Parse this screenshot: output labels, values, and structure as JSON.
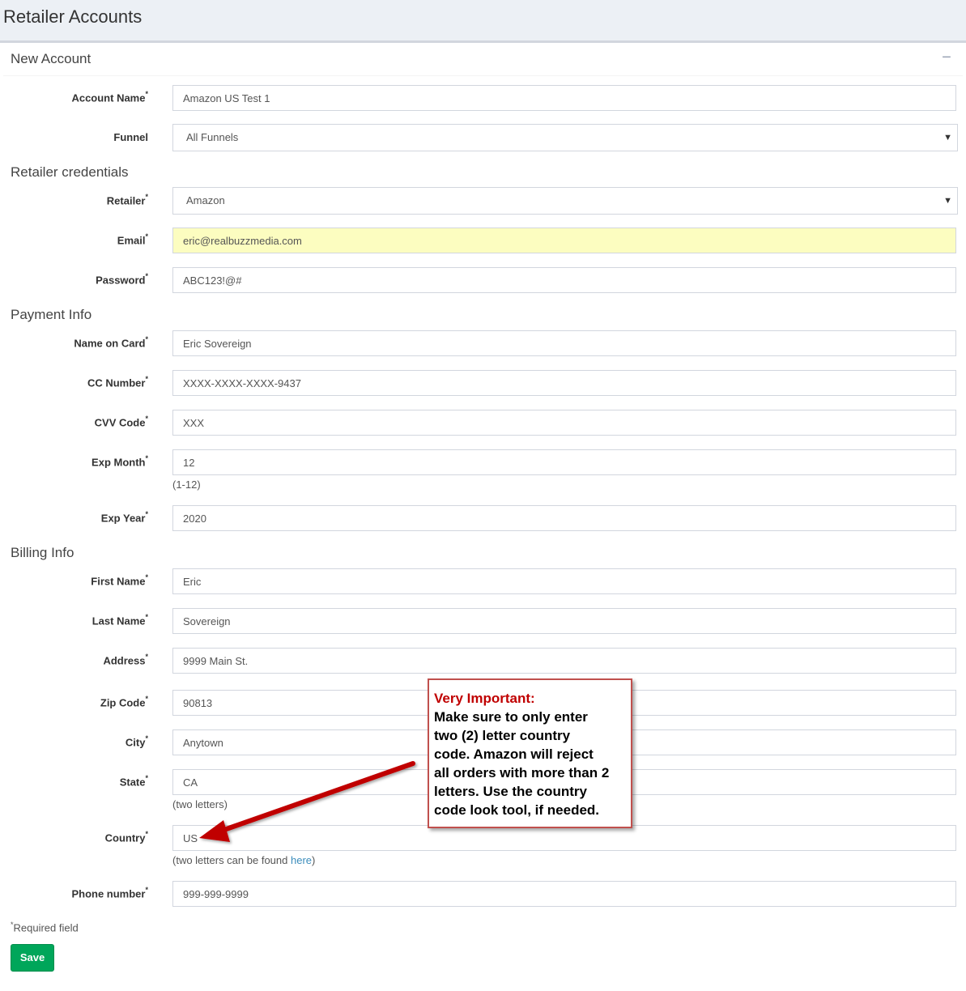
{
  "page": {
    "title": "Retailer Accounts"
  },
  "box": {
    "title": "New Account",
    "collapse_symbol": "−"
  },
  "fields": {
    "account_name": {
      "label": "Account Name",
      "value": "Amazon US Test 1"
    },
    "funnel": {
      "label": "Funnel",
      "value": "All Funnels"
    },
    "retailer": {
      "label": "Retailer",
      "value": "Amazon"
    },
    "email": {
      "label": "Email",
      "value": "eric@realbuzzmedia.com"
    },
    "password": {
      "label": "Password",
      "value": "ABC123!@#"
    },
    "name_on_card": {
      "label": "Name on Card",
      "value": "Eric Sovereign"
    },
    "cc_number": {
      "label": "CC Number",
      "value": "XXXX-XXXX-XXXX-9437"
    },
    "cvv_code": {
      "label": "CVV Code",
      "value": "XXX"
    },
    "exp_month": {
      "label": "Exp Month",
      "value": "12",
      "help": "(1-12)"
    },
    "exp_year": {
      "label": "Exp Year",
      "value": "2020"
    },
    "first_name": {
      "label": "First Name",
      "value": "Eric"
    },
    "last_name": {
      "label": "Last Name",
      "value": "Sovereign"
    },
    "address": {
      "label": "Address",
      "value": "9999 Main St."
    },
    "zip_code": {
      "label": "Zip Code",
      "value": "90813"
    },
    "city": {
      "label": "City",
      "value": "Anytown"
    },
    "state": {
      "label": "State",
      "value": "CA",
      "help": "(two letters)"
    },
    "country": {
      "label": "Country",
      "value": "US",
      "help_prefix": "(two letters can be found ",
      "help_link": "here",
      "help_suffix": ")"
    },
    "phone": {
      "label": "Phone number",
      "value": "999-999-9999"
    }
  },
  "sections": {
    "credentials": "Retailer credentials",
    "payment": "Payment Info",
    "billing": "Billing Info"
  },
  "required_marker": "*",
  "required_note": "Required field",
  "save_label": "Save",
  "callout": {
    "heading": "Very Important:",
    "lines": [
      "Make sure to only enter",
      "two (2) letter country",
      "code.  Amazon will reject",
      "all orders with more than 2",
      "letters.  Use the country",
      "code look tool, if needed."
    ]
  },
  "colors": {
    "save_button": "#00a65a",
    "callout_border": "#c0504d",
    "callout_heading": "#c00000",
    "arrow": "#c00000",
    "autofill_highlight": "#fcfdc0",
    "link": "#3c8dbc"
  }
}
